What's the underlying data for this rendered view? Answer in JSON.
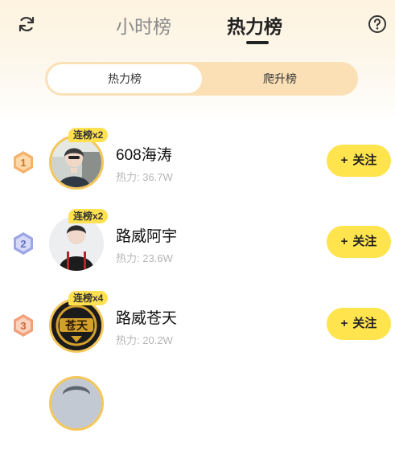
{
  "header": {
    "refresh_icon": "refresh-icon",
    "help_icon": "question-circle-icon",
    "tabs": [
      {
        "label": "小时榜",
        "active": false
      },
      {
        "label": "热力榜",
        "active": true
      }
    ]
  },
  "segment": {
    "options": [
      {
        "label": "热力榜",
        "active": true
      },
      {
        "label": "爬升榜",
        "active": false
      }
    ]
  },
  "colors": {
    "accent_yellow": "#ffe44d",
    "rank1": "#f6b26b",
    "rank2": "#9ea7e6",
    "rank3": "#f2a07a"
  },
  "rows": [
    {
      "rank": "1",
      "streak": "连榜x2",
      "name": "608海涛",
      "heat": "热力: 36.7W",
      "follow": "关注",
      "plus": "+"
    },
    {
      "rank": "2",
      "streak": "连榜x2",
      "name": "路威阿宇",
      "heat": "热力: 23.6W",
      "follow": "关注",
      "plus": "+"
    },
    {
      "rank": "3",
      "streak": "连榜x4",
      "name": "路威苍天",
      "heat": "热力: 20.2W",
      "follow": "关注",
      "plus": "+",
      "avatar_text": "苍天"
    }
  ]
}
